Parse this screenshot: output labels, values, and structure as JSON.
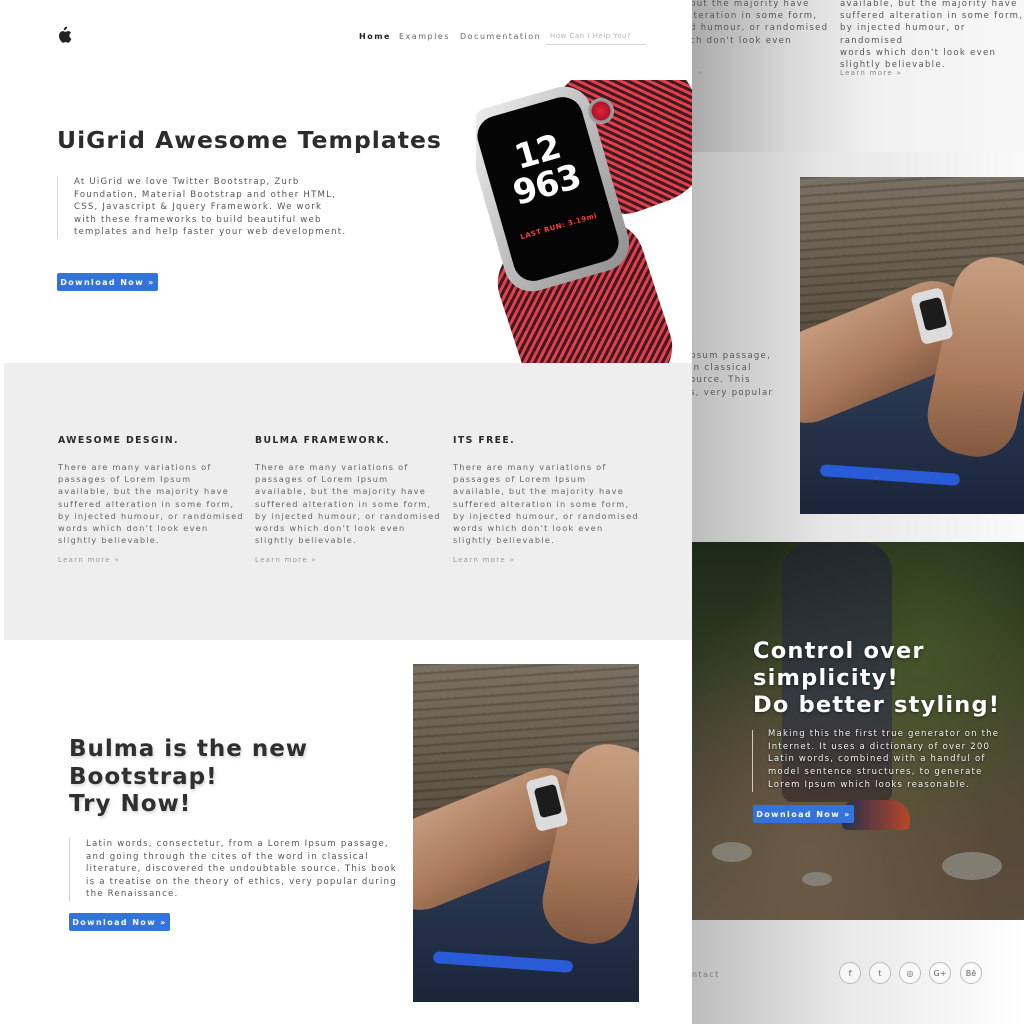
{
  "nav": {
    "items": [
      {
        "label": "Home"
      },
      {
        "label": "Examples"
      },
      {
        "label": "Documentation"
      }
    ],
    "search_placeholder": "How Can I Help You?"
  },
  "hero": {
    "title": "UiGrid Awesome Templates",
    "text": "At UiGrid we love Twitter Bootstrap, Zurb Foundation, Material Bootstrap and other HTML, CSS, Javascript & Jquery Framework. We work with these frameworks to build beautiful web templates and help faster your web development.",
    "button_label": "Download Now »",
    "watch_time": "12\n963",
    "watch_sub": "LAST RUN: 3.19mi"
  },
  "features": [
    {
      "title": "AWESOME DESGIN.",
      "text": "There are many variations of passages of Lorem Ipsum available, but the majority have suffered alteration in some form, by injected humour, or randomised words which don't look even slightly believable.",
      "link": "Learn more »"
    },
    {
      "title": "BULMA FRAMEWORK.",
      "text": "There are many variations of passages of Lorem Ipsum available, but the majority have suffered alteration in some form, by injected humour, or randomised words which don't look even slightly believable.",
      "link": "Learn more »"
    },
    {
      "title": "ITS FREE.",
      "text": "There are many variations of passages of Lorem Ipsum available, but the majority have suffered alteration in some form, by injected humour, or randomised words which don't look even slightly believable.",
      "link": "Learn more »"
    }
  ],
  "bulma": {
    "title": "Bulma is the new\nBootstrap!\nTry Now!",
    "text": "Latin words, consectetur, from a Lorem Ipsum passage, and going through the cites of the word in classical literature, discovered the undoubtable source. This book is a treatise on the theory of ethics, very popular during the Renaissance.",
    "button_label": "Download Now »"
  },
  "right_page": {
    "top_col1": "but the majority have\nlteration in some form,\nd humour, or randomised\nch don't look even",
    "top_col1_link": "»",
    "top_col2": "available, but the majority have\nsuffered alteration in some form,\nby injected humour, or randomised\nwords which don't look even\nslightly believable.",
    "top_col2_link": "Learn more »",
    "mid_text": "psum passage,\nin classical\nource. This\ns, very popular",
    "hero_title": "Control over\nsimplicity!\nDo better styling!",
    "hero_text": "Making this the first true generator on the Internet. It uses a dictionary of over 200 Latin words, combined with a handful of model sentence structures, to generate Lorem Ipsum which looks reasonable.",
    "hero_button": "Download Now »",
    "footer_contact": "ntact",
    "social": [
      {
        "icon": "facebook-icon",
        "glyph": "f"
      },
      {
        "icon": "twitter-icon",
        "glyph": "t"
      },
      {
        "icon": "instagram-icon",
        "glyph": "◎"
      },
      {
        "icon": "google-plus-icon",
        "glyph": "G+"
      },
      {
        "icon": "behance-icon",
        "glyph": "Bē"
      }
    ]
  },
  "colors": {
    "primary": "#3273dc",
    "band_red": "#e63d4a",
    "feature_bg": "#eeeeee"
  }
}
